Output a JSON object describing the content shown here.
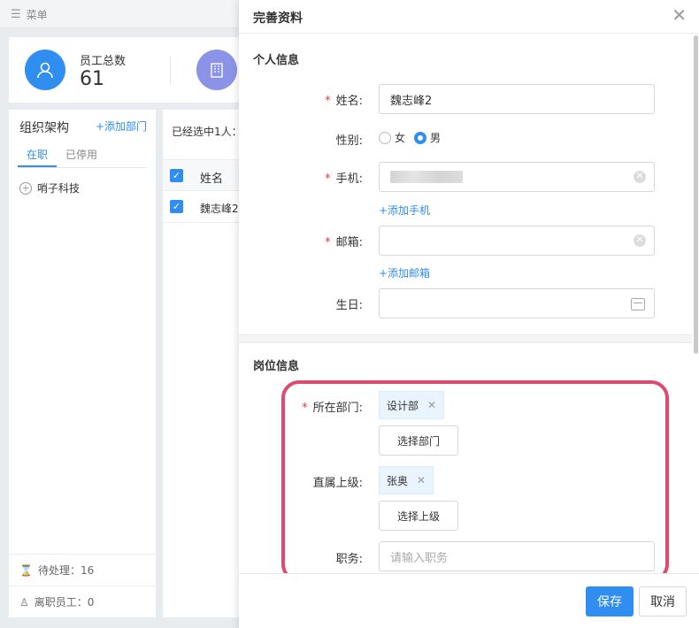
{
  "topbar": {
    "menu_label": "菜单"
  },
  "stats": {
    "employee_total_label": "员工总数",
    "employee_total_value": "61"
  },
  "org": {
    "title": "组织架构",
    "add_dept": "+添加部门",
    "tabs": [
      "在职",
      "已停用"
    ],
    "root_node": "哨子科技",
    "pending": "待处理：16",
    "resigned": "离职员工：0"
  },
  "list": {
    "selected_info": "已经选中1人：",
    "col_name": "姓名",
    "rows": [
      "魏志峰2"
    ]
  },
  "drawer": {
    "title": "完善资料",
    "personal_section": "个人信息",
    "name_label": "姓名:",
    "name_value": "魏志峰2",
    "gender_label": "性别:",
    "gender_female": "女",
    "gender_male": "男",
    "phone_label": "手机:",
    "add_phone": "+添加手机",
    "email_label": "邮箱:",
    "add_email": "+添加邮箱",
    "birthday_label": "生日:",
    "job_section": "岗位信息",
    "dept_label": "所在部门:",
    "dept_tag": "设计部",
    "select_dept": "选择部门",
    "manager_label": "直属上级:",
    "manager_tag": "张奥",
    "select_manager": "选择上级",
    "position_label": "职务:",
    "position_placeholder": "请输入职务",
    "save": "保存",
    "cancel": "取消"
  },
  "colors": {
    "accent": "#2f8ef0",
    "highlight": "#e04a6e",
    "required": "#e4393c"
  }
}
